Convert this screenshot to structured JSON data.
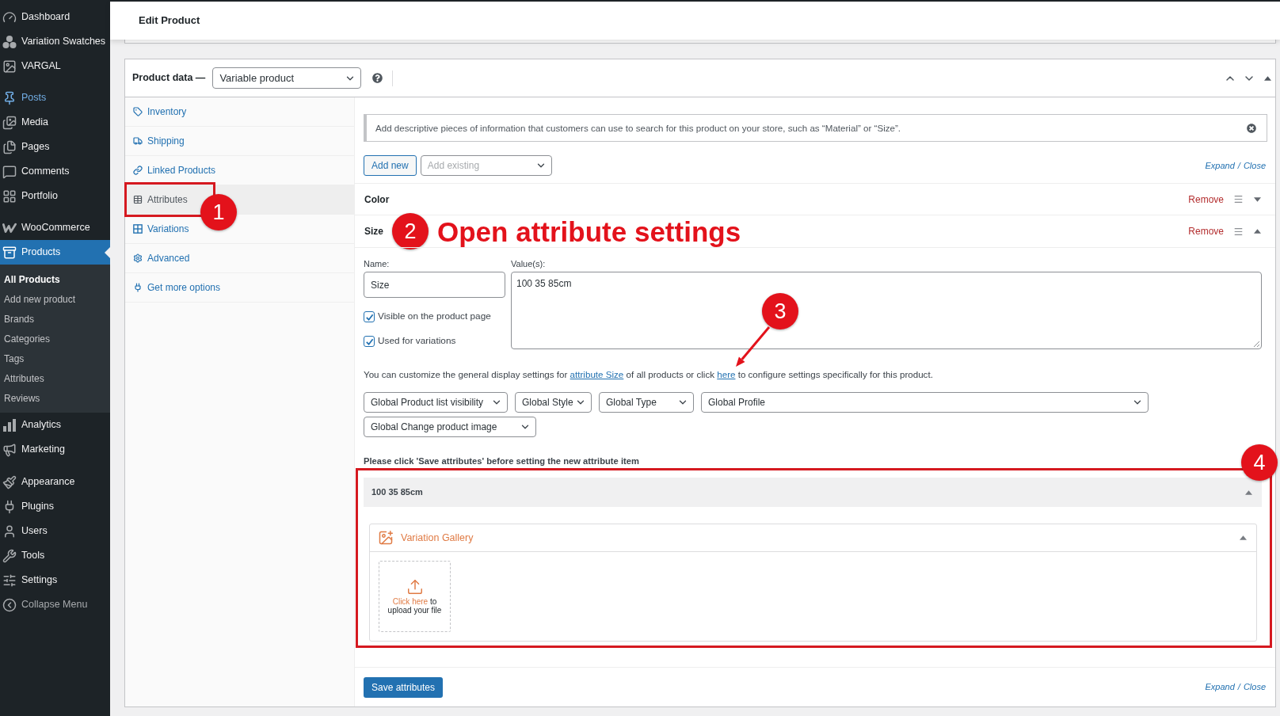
{
  "sidebar": {
    "sections": [
      {
        "items": [
          {
            "label": "Dashboard",
            "selected": false,
            "hovered": false
          },
          {
            "label": "Variation Swatches",
            "selected": false,
            "hovered": false
          },
          {
            "label": "VARGAL",
            "selected": false,
            "hovered": false
          }
        ]
      },
      {
        "items": [
          {
            "label": "Posts",
            "selected": false,
            "hovered": true
          },
          {
            "label": "Media",
            "selected": false,
            "hovered": false
          },
          {
            "label": "Pages",
            "selected": false,
            "hovered": false
          },
          {
            "label": "Comments",
            "selected": false,
            "hovered": false
          },
          {
            "label": "Portfolio",
            "selected": false,
            "hovered": false
          }
        ]
      },
      {
        "items": [
          {
            "label": "WooCommerce",
            "selected": false,
            "hovered": false
          },
          {
            "label": "Products",
            "selected": true,
            "hovered": false,
            "children": [
              {
                "label": "All Products",
                "selected": true
              },
              {
                "label": "Add new product",
                "selected": false
              },
              {
                "label": "Brands",
                "selected": false
              },
              {
                "label": "Categories",
                "selected": false
              },
              {
                "label": "Tags",
                "selected": false
              },
              {
                "label": "Attributes",
                "selected": false
              },
              {
                "label": "Reviews",
                "selected": false
              }
            ]
          },
          {
            "label": "Analytics",
            "selected": false,
            "hovered": false
          },
          {
            "label": "Marketing",
            "selected": false,
            "hovered": false
          }
        ]
      },
      {
        "items": [
          {
            "label": "Appearance",
            "selected": false,
            "hovered": false
          },
          {
            "label": "Plugins",
            "selected": false,
            "hovered": false
          },
          {
            "label": "Users",
            "selected": false,
            "hovered": false
          },
          {
            "label": "Tools",
            "selected": false,
            "hovered": false
          },
          {
            "label": "Settings",
            "selected": false,
            "hovered": false
          }
        ]
      }
    ],
    "collapse": {
      "label": "Collapse Menu"
    }
  },
  "header": {
    "title": "Edit Product"
  },
  "product_data": {
    "label": "Product data —",
    "product_type": {
      "value": "Variable product"
    },
    "expanded": true,
    "tabs": [
      {
        "label": "Inventory",
        "selected": false
      },
      {
        "label": "Shipping",
        "selected": false
      },
      {
        "label": "Linked Products",
        "selected": false
      },
      {
        "label": "Attributes",
        "selected": true
      },
      {
        "label": "Variations",
        "selected": false
      },
      {
        "label": "Advanced",
        "selected": false
      },
      {
        "label": "Get more options",
        "selected": false
      }
    ],
    "notice": "Add descriptive pieces of information that customers can use to search for this product on your store, such as “Material” or “Size”.",
    "add_new": "Add new",
    "add_existing": {
      "placeholder": "Add existing"
    },
    "expand_close_top": {
      "expand": "Expand",
      "separator": "/",
      "close": "Close"
    },
    "attributes": [
      {
        "name": "Color",
        "remove": "Remove",
        "expanded": false
      },
      {
        "name": "Size",
        "remove": "Remove",
        "expanded": true,
        "details": {
          "name_label": "Name:",
          "name_value": "Size",
          "values_label": "Value(s):",
          "values_value": "100 35 85cm",
          "options": [
            {
              "label": "Visible on the product page",
              "checked": true
            },
            {
              "label": "Used for variations",
              "checked": true
            }
          ],
          "help_text": {
            "before": "You can customize the general display settings for",
            "first_link": "attribute Size",
            "middle": "of all products or click",
            "second_link": "here",
            "after": "to configure settings specifically for this product."
          },
          "display_selects": [
            {
              "value": "Global Product list visibility"
            },
            {
              "value": "Global Style"
            },
            {
              "value": "Global Type"
            },
            {
              "value": "Global Profile"
            },
            {
              "value": "Global Change product image"
            }
          ],
          "save_note": "Please click 'Save attributes' before setting the new attribute item",
          "terms": [
            {
              "label": "100 35 85cm",
              "expanded": true,
              "gallery": {
                "title": "Variation Gallery",
                "expanded": true,
                "upload_link": "Click here",
                "upload_text": "to upload your file"
              }
            }
          ]
        }
      }
    ],
    "save_button": "Save attributes",
    "expand_close_bottom": {
      "expand": "Expand",
      "separator": "/",
      "close": "Close"
    }
  },
  "annotations": [
    {
      "kind": "tab_frame",
      "number": "1"
    },
    {
      "kind": "caption",
      "number": "2",
      "caption": "Open attribute settings"
    },
    {
      "kind": "arrow",
      "number": "3"
    },
    {
      "kind": "section_frame",
      "number": "4"
    }
  ]
}
